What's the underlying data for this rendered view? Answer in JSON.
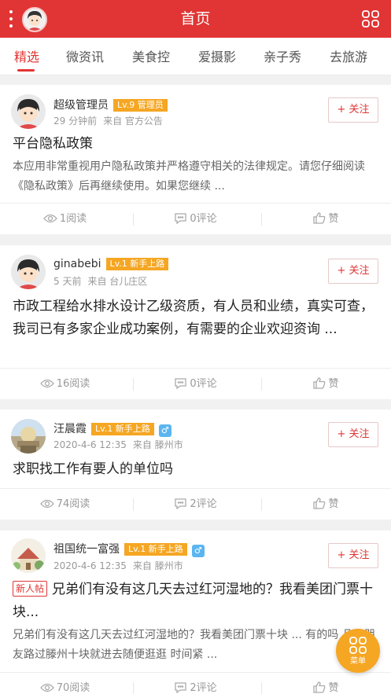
{
  "header": {
    "title": "首页"
  },
  "tabs": [
    "精选",
    "微资讯",
    "美食控",
    "爱摄影",
    "亲子秀",
    "去旅游"
  ],
  "posts": [
    {
      "user": "超级管理员",
      "level": "Lv.9 管理员",
      "gender": "",
      "time": "29 分钟前",
      "source": "来自 官方公告",
      "follow": "+ 关注",
      "new_badge": "",
      "title": "平台隐私政策",
      "summary": "本应用非常重视用户隐私政策并严格遵守相关的法律规定。请您仔细阅读《隐私政策》后再继续使用。如果您继续 ...",
      "reads": "1阅读",
      "comments": "0评论",
      "likes": "赞"
    },
    {
      "user": "ginabebi",
      "level": "Lv.1 新手上路",
      "gender": "",
      "time": "5 天前",
      "source": "来自 台儿庄区",
      "follow": "+ 关注",
      "new_badge": "",
      "title": "市政工程给水排水设计乙级资质，有人员和业绩，真实可查，我司已有多家企业成功案例，有需要的企业欢迎资询 ...",
      "summary": "",
      "reads": "16阅读",
      "comments": "0评论",
      "likes": "赞"
    },
    {
      "user": "汪晨霞",
      "level": "Lv.1 新手上路",
      "gender": "♂",
      "time": "2020-4-6 12:35",
      "source": "来自 滕州市",
      "follow": "+ 关注",
      "new_badge": "",
      "title": "求职找工作有要人的单位吗",
      "summary": "",
      "reads": "74阅读",
      "comments": "2评论",
      "likes": "赞"
    },
    {
      "user": "祖国统一富强",
      "level": "Lv.1 新手上路",
      "gender": "♂",
      "time": "2020-4-6 12:35",
      "source": "来自 滕州市",
      "follow": "+ 关注",
      "new_badge": "新人帖",
      "title": "兄弟们有没有这几天去过红河湿地的？我看美团门票十块...",
      "summary": "兄弟们有没有这几天去过红河湿地的？我看美团门票十块 ... 有的吗 几个朋友路过滕州十块就进去随便逛逛 时间紧 ...",
      "reads": "70阅读",
      "comments": "2评论",
      "likes": "赞"
    }
  ],
  "fab": {
    "label": "菜单"
  },
  "colors": {
    "brand": "#e03534",
    "level": "#f5a623",
    "gender": "#5bb5f0"
  }
}
